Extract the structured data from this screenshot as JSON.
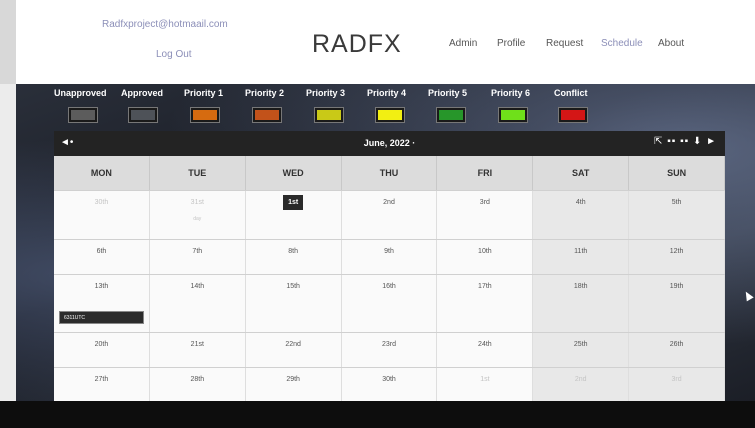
{
  "header": {
    "email": "Radfxproject@hotmaail.com",
    "logout": "Log Out",
    "logo": "RADFX",
    "nav": [
      "Admin",
      "Profile",
      "Request",
      "Schedule",
      "About"
    ],
    "active_nav": "Schedule"
  },
  "legend": [
    {
      "label": "Unapproved",
      "color": "#5c5c5c"
    },
    {
      "label": "Approved",
      "color": "#4e5258"
    },
    {
      "label": "Priority 1",
      "color": "#d66b10"
    },
    {
      "label": "Priority 2",
      "color": "#c2521a"
    },
    {
      "label": "Priority 3",
      "color": "#c9c917"
    },
    {
      "label": "Priority 4",
      "color": "#f2ef12"
    },
    {
      "label": "Priority 5",
      "color": "#27962a"
    },
    {
      "label": "Priority 6",
      "color": "#6fe01a"
    },
    {
      "label": "Conflict",
      "color": "#d41616"
    }
  ],
  "calendar": {
    "month_label": "June, 2022 ·",
    "prev_icon": "◄•",
    "right_controls": "⇱ ▪▪ ▪▪ ⬇ ►",
    "days_of_week": [
      "MON",
      "TUE",
      "WED",
      "THU",
      "FRI",
      "SAT",
      "SUN"
    ],
    "weeks": [
      [
        "30th",
        "31st",
        "1st",
        "2nd",
        "3rd",
        "4th",
        "5th"
      ],
      [
        "6th",
        "7th",
        "8th",
        "9th",
        "10th",
        "11th",
        "12th"
      ],
      [
        "13th",
        "14th",
        "15th",
        "16th",
        "17th",
        "18th",
        "19th"
      ],
      [
        "20th",
        "21st",
        "22nd",
        "23rd",
        "24th",
        "25th",
        "26th"
      ],
      [
        "27th",
        "28th",
        "29th",
        "30th",
        "1st",
        "2nd",
        "3rd"
      ]
    ],
    "tue_31_note": "day",
    "event_label": "6311UTC"
  }
}
